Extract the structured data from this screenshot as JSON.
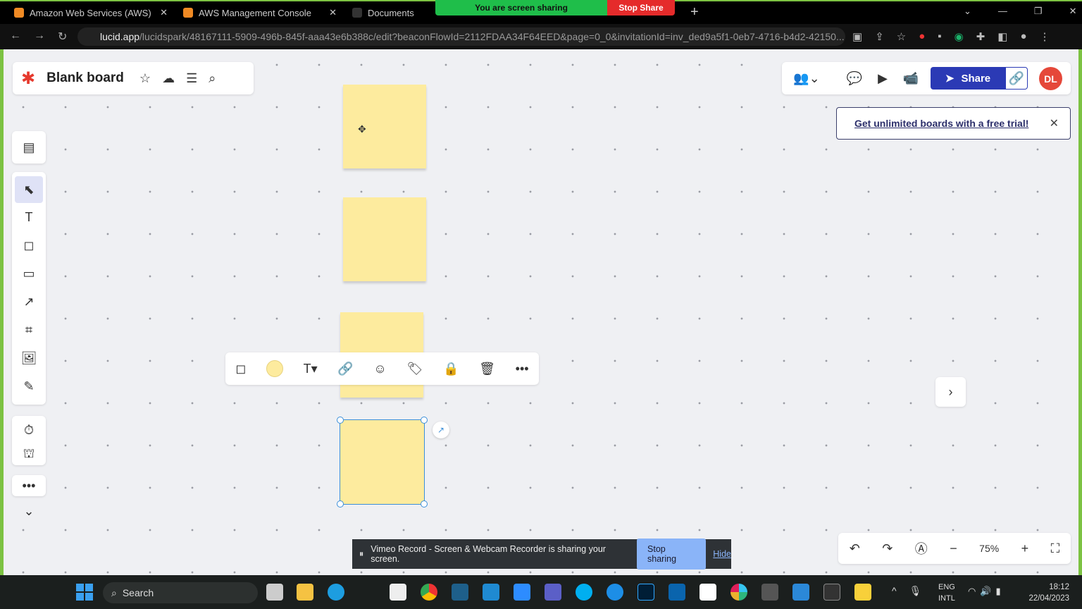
{
  "browser": {
    "tabs": [
      {
        "label": "Amazon Web Services (AWS)"
      },
      {
        "label": "AWS Management Console"
      },
      {
        "label": "Documents"
      }
    ],
    "screen_share": {
      "status": "You are screen sharing",
      "stop": "Stop Share"
    },
    "url_host": "lucid.app",
    "url_path": "/lucidspark/48167111-5909-496b-845f-aaa43e6b388c/edit?beaconFlowId=2112FDAA34F64EED&page=0_0&invitationId=inv_ded9a5f1-0eb7-4716-b4d2-42150..."
  },
  "board": {
    "title": "Blank board",
    "share_label": "Share",
    "avatar": "DL",
    "promo": "Get unlimited boards with a free trial!",
    "zoom": "75%"
  },
  "colors": {
    "sticky": "#fdeb9e",
    "accent": "#2b3ab5",
    "avatar": "#e5483a"
  },
  "vimeo": {
    "message": "Vimeo Record - Screen & Webcam Recorder is sharing your screen.",
    "stop": "Stop sharing",
    "hide": "Hide"
  },
  "taskbar": {
    "search": "Search",
    "lang1": "ENG",
    "lang2": "INTL",
    "time": "18:12",
    "date": "22/04/2023"
  }
}
